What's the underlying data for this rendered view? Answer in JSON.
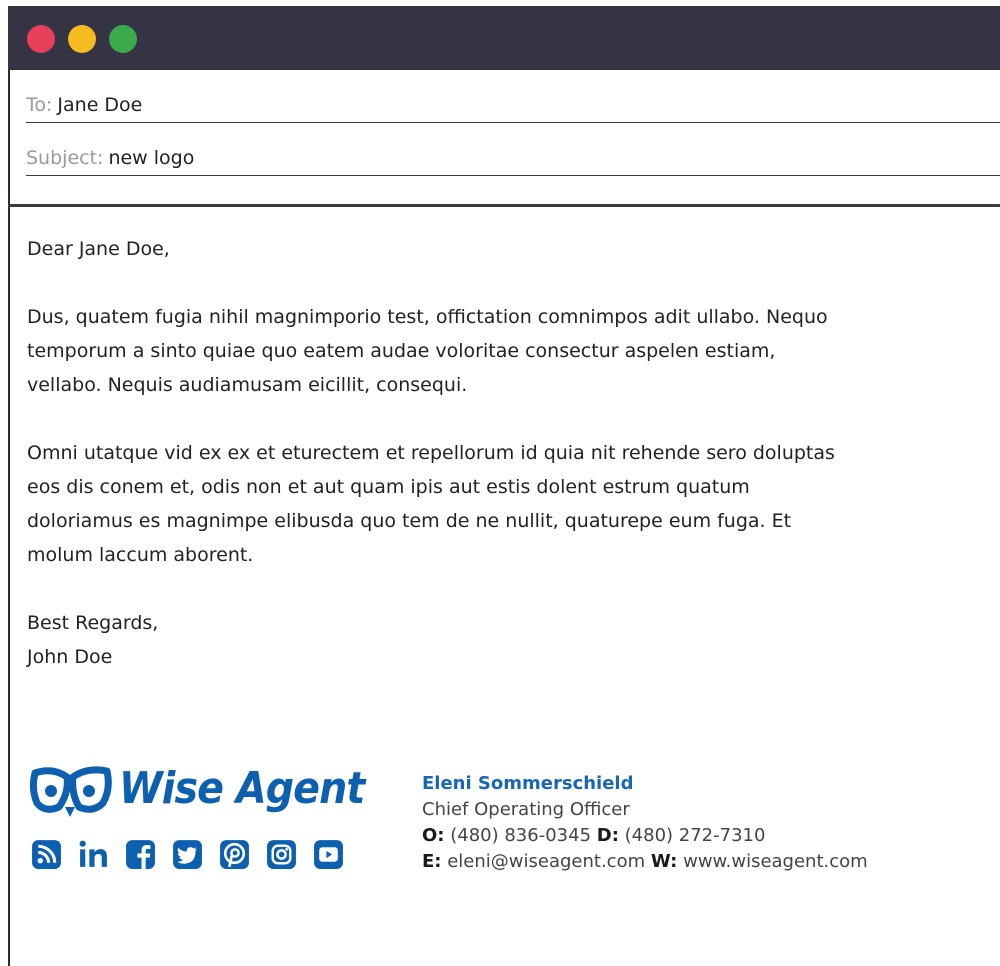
{
  "window": {
    "controls": [
      "close",
      "minimize",
      "maximize"
    ],
    "colors": {
      "titlebar": "#353444",
      "close": "#e8405a",
      "minimize": "#f6bb1e",
      "maximize": "#3aaa4c"
    }
  },
  "header": {
    "to_label": "To:",
    "to_value": "Jane Doe",
    "subject_label": "Subject:",
    "subject_value": "new logo"
  },
  "body": {
    "greeting": "Dear Jane Doe,",
    "paragraphs": [
      "Dus, quatem fugia nihil magnimporio test, offictation comnimpos adit ullabo. Nequo temporum a sinto quiae quo eatem audae voloritae consectur aspelen estiam, vellabo. Nequis audiamusam eicillit, consequi.",
      "Omni utatque vid ex ex et eturectem et repellorum id quia nit rehende sero doluptas eos dis conem et, odis non et aut quam ipis aut estis dolent estrum quatum doloriamus es magnimpe elibusda quo tem de ne nullit, quaturepe eum fuga. Et molum laccum aborent."
    ],
    "closing": "Best Regards,",
    "sender": "John Doe"
  },
  "signature": {
    "logo_text": "Wise Agent",
    "brand_color": "#0d5fb0",
    "name": "Eleni Sommerschield",
    "title": "Chief Operating Officer",
    "office_label": "O:",
    "office_phone": "(480) 836-0345",
    "direct_label": "D:",
    "direct_phone": "(480) 272-7310",
    "email_label": "E:",
    "email": "eleni@wiseagent.com",
    "web_label": "W:",
    "website": "www.wiseagent.com",
    "social_icons": [
      "rss-icon",
      "linkedin-icon",
      "facebook-icon",
      "twitter-icon",
      "pinterest-icon",
      "instagram-icon",
      "youtube-icon"
    ]
  }
}
